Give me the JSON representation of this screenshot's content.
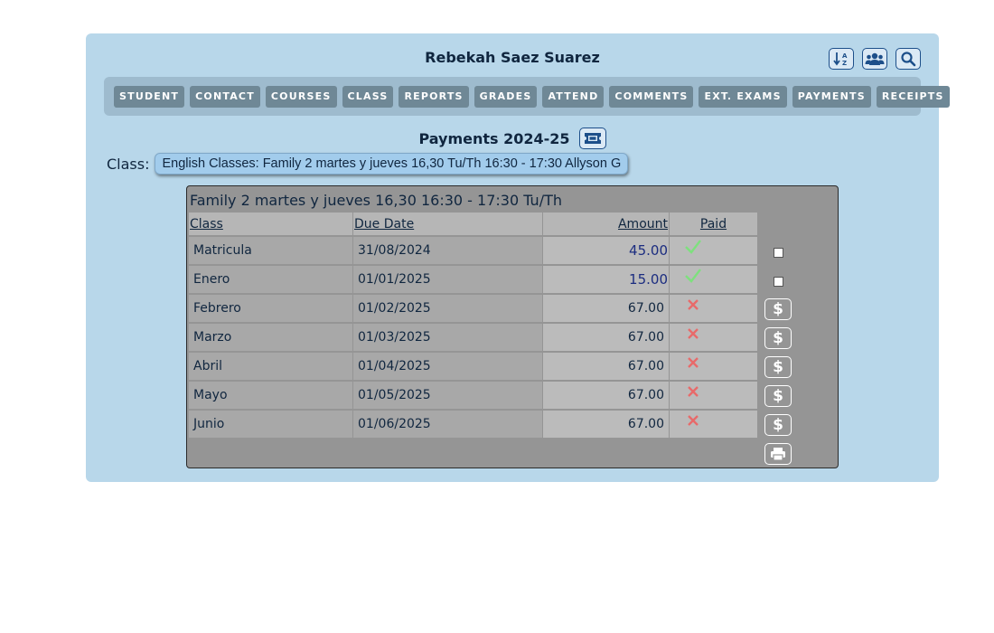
{
  "student": {
    "name": "Rebekah Saez Suarez"
  },
  "toolbar": {
    "icons": [
      "sort-az-icon",
      "users-group-icon",
      "search-icon"
    ]
  },
  "tabs": [
    "STUDENT",
    "CONTACT",
    "COURSES",
    "CLASS",
    "REPORTS",
    "GRADES",
    "ATTEND",
    "COMMENTS",
    "EXT. EXAMS",
    "PAYMENTS",
    "RECEIPTS"
  ],
  "payments": {
    "title": "Payments 2024-25",
    "ticket_icon": "ticket-icon"
  },
  "class_select": {
    "label": "Class:",
    "value": "English Classes: Family 2 martes y jueves 16,30 Tu/Th 16:30 - 17:30 Allyson G"
  },
  "table": {
    "title": "Family 2 martes y jueves 16,30 16:30 - 17:30 Tu/Th",
    "headers": {
      "class": "Class",
      "due_date": "Due Date",
      "amount": "Amount",
      "paid": "Paid"
    },
    "rows": [
      {
        "class": "Matricula",
        "due_date": "31/08/2024",
        "amount": "45.00",
        "paid": true
      },
      {
        "class": "Enero",
        "due_date": "01/01/2025",
        "amount": "15.00",
        "paid": true
      },
      {
        "class": "Febrero",
        "due_date": "01/02/2025",
        "amount": "67.00",
        "paid": false
      },
      {
        "class": "Marzo",
        "due_date": "01/03/2025",
        "amount": "67.00",
        "paid": false
      },
      {
        "class": "Abril",
        "due_date": "01/04/2025",
        "amount": "67.00",
        "paid": false
      },
      {
        "class": "Mayo",
        "due_date": "01/05/2025",
        "amount": "67.00",
        "paid": false
      },
      {
        "class": "Junio",
        "due_date": "01/06/2025",
        "amount": "67.00",
        "paid": false
      }
    ],
    "pay_button_label": "$",
    "print_icon": "printer-icon"
  },
  "colors": {
    "panel": "#b8d7ea",
    "tab": "#6f8896",
    "paid_check": "#7ee07e",
    "unpaid_cross": "#e86a6a",
    "paid_amount": "#1c2d80"
  }
}
